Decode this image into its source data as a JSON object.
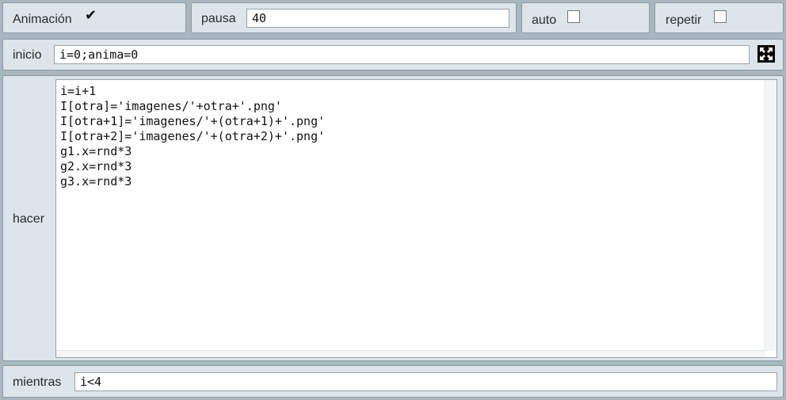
{
  "animacion": {
    "label": "Animación",
    "checked": true
  },
  "pausa": {
    "label": "pausa",
    "value": "40"
  },
  "auto": {
    "label": "auto",
    "checked": false
  },
  "repetir": {
    "label": "repetir",
    "checked": false
  },
  "inicio": {
    "label": "inicio",
    "value": "i=0;anima=0",
    "expand_icon": "expand-icon"
  },
  "hacer": {
    "label": "hacer",
    "lines": [
      "i=i+1",
      "I[otra]='imagenes/'+otra+'.png'",
      "I[otra+1]='imagenes/'+(otra+1)+'.png'",
      "I[otra+2]='imagenes/'+(otra+2)+'.png'",
      "g1.x=rnd*3",
      "g2.x=rnd*3",
      "g3.x=rnd*3"
    ]
  },
  "mientras": {
    "label": "mientras",
    "value": "i<4"
  }
}
